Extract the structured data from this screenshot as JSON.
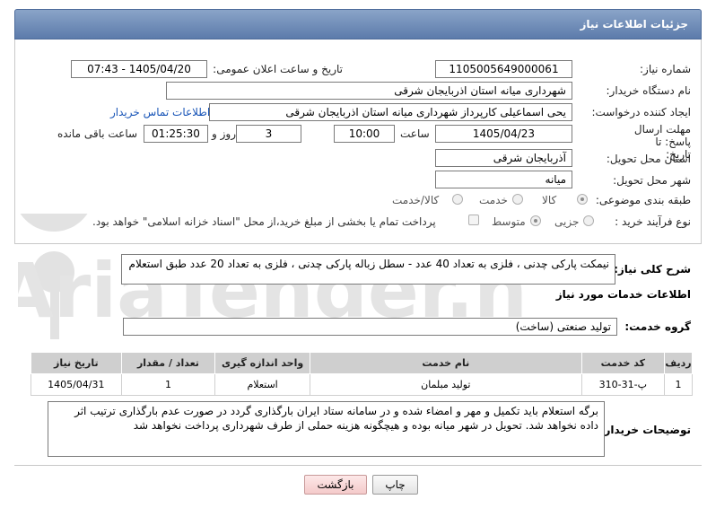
{
  "header": {
    "title": "جزئیات اطلاعات نیاز"
  },
  "form": {
    "need_number_label": "شماره نیاز:",
    "need_number": "1105005649000061",
    "announce_label": "تاریخ و ساعت اعلان عمومی:",
    "announce_value": "1405/04/20 - 07:43",
    "buyer_label": "نام دستگاه خریدار:",
    "buyer_value": "شهرداری میانه استان اذربایجان شرقی",
    "creator_label": "ایجاد کننده درخواست:",
    "creator_value": "یحی اسماعیلی  کارپرداز شهرداری میانه استان اذربایجان شرقی",
    "contact_link": "اطلاعات تماس خریدار",
    "deadline_label": "مهلت ارسال پاسخ: تا تاریخ:",
    "deadline_date": "1405/04/23",
    "time_label": "ساعت",
    "deadline_time": "10:00",
    "days_value": "3",
    "days_label": "روز و",
    "remaining_time": "01:25:30",
    "remaining_label": "ساعت باقی مانده",
    "province_label": "استان محل تحویل:",
    "province_value": "آذربایجان شرقی",
    "city_label": "شهر محل تحویل:",
    "city_value": "میانه",
    "category_label": "طبقه بندی موضوعی:",
    "category_options": [
      "کالا",
      "خدمت",
      "کالا/خدمت"
    ],
    "category_selected": "کالا",
    "process_label": "نوع فرآیند خرید :",
    "process_options": [
      "جزیی",
      "متوسط"
    ],
    "process_selected": "متوسط",
    "payment_note": "پرداخت تمام یا بخشی از مبلغ خرید،از محل \"اسناد خزانه اسلامی\" خواهد بود."
  },
  "description": {
    "label": "شرح کلی نیاز:",
    "value": "نیمکت پارکی چدنی ، فلزی به تعداد 40 عدد - سطل زباله پارکی چدنی ، فلزی به تعداد 20 عدد طبق استعلام"
  },
  "services": {
    "section_title": "اطلاعات خدمات مورد نیاز",
    "group_label": "گروه خدمت:",
    "group_value": "تولید صنعتی (ساخت)",
    "columns": [
      "ردیف",
      "کد خدمت",
      "نام خدمت",
      "واحد اندازه گیری",
      "تعداد / مقدار",
      "تاریخ نیاز"
    ],
    "rows": [
      [
        "1",
        "پ-31-310",
        "تولید مبلمان",
        "استعلام",
        "1",
        "1405/04/31"
      ]
    ]
  },
  "buyer_notes": {
    "label": "توضیحات خریدار:",
    "value": "برگه استعلام باید تکمیل و مهر و امضاء شده و در سامانه ستاد ایران بارگذاری گردد در صورت عدم بارگذاری ترتیب اثر داده نخواهد شد. تحویل در شهر میانه بوده و هیچگونه هزینه حملی از طرف شهرداری پرداخت نخواهد شد"
  },
  "buttons": {
    "print": "چاپ",
    "back": "بازگشت"
  },
  "watermark": {
    "text": "AriaTender.net"
  },
  "colors": {
    "header": "#6d88b6",
    "link": "#1a56b8",
    "back_button": "#f4caca"
  }
}
